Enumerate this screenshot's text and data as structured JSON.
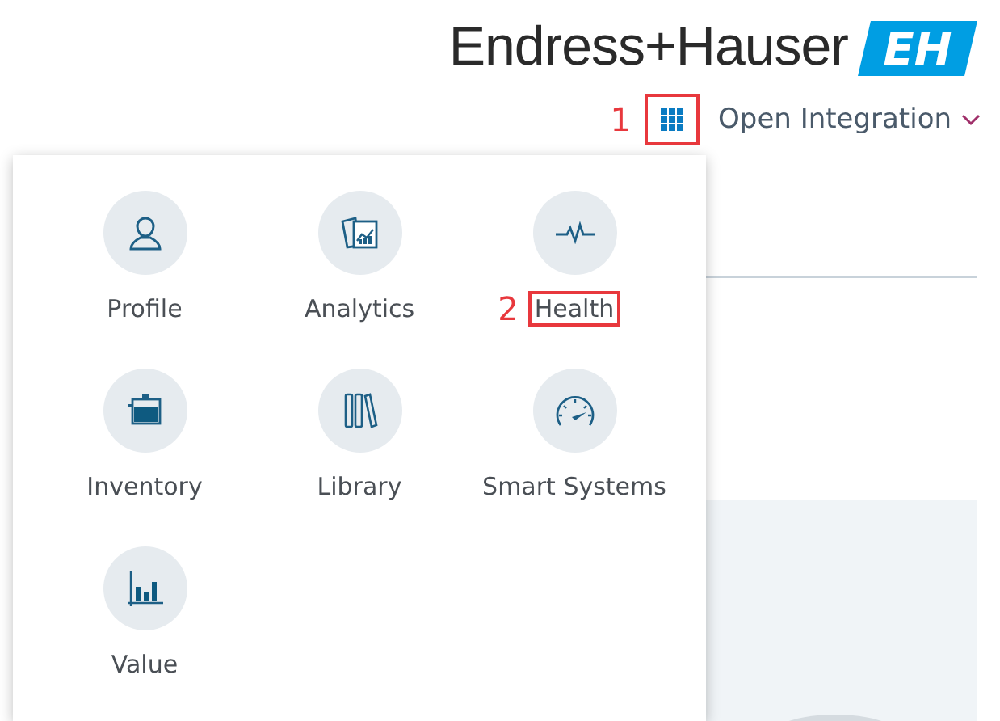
{
  "header": {
    "brand": "Endress+Hauser",
    "logo_mark": "EH",
    "apps_button": {
      "marker": "1",
      "highlighted": true
    },
    "workspace": "Open Integration"
  },
  "apps_menu": {
    "items": [
      {
        "label": "Profile",
        "kind": "person",
        "marker": "",
        "highlighted": false
      },
      {
        "label": "Analytics",
        "kind": "analytics",
        "marker": "",
        "highlighted": false
      },
      {
        "label": "Health",
        "kind": "pulse",
        "marker": "2",
        "highlighted": true
      },
      {
        "label": "Inventory",
        "kind": "tank",
        "marker": "",
        "highlighted": false
      },
      {
        "label": "Library",
        "kind": "books",
        "marker": "",
        "highlighted": false
      },
      {
        "label": "Smart Systems",
        "kind": "gauge",
        "marker": "",
        "highlighted": false
      },
      {
        "label": "Value",
        "kind": "barchart",
        "marker": "",
        "highlighted": false
      }
    ]
  }
}
